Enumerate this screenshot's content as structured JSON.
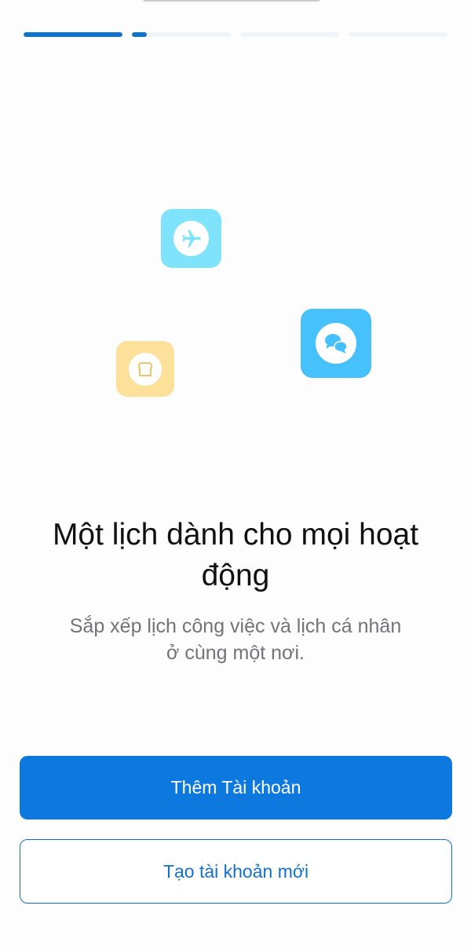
{
  "progress": {
    "segments": [
      {
        "fill": 1.0
      },
      {
        "fill": 0.15
      },
      {
        "fill": 0.0
      },
      {
        "fill": 0.0
      }
    ],
    "active_color": "#0f74d0",
    "inactive_color": "#eef6fb"
  },
  "illustration": {
    "icons": [
      {
        "name": "airplane-icon",
        "color": "#7fe4fb"
      },
      {
        "name": "chat-bubbles-icon",
        "color": "#46c1fb"
      },
      {
        "name": "bread-toast-icon",
        "color": "#fde19b"
      }
    ]
  },
  "onboarding": {
    "title": "Một lịch dành cho mọi hoạt động",
    "subtitle": "Sắp xếp lịch công việc và lịch cá nhân ở cùng một nơi."
  },
  "actions": {
    "add_account_label": "Thêm Tài khoản",
    "create_account_label": "Tạo tài khoản mới",
    "primary_color": "#0d78de"
  }
}
